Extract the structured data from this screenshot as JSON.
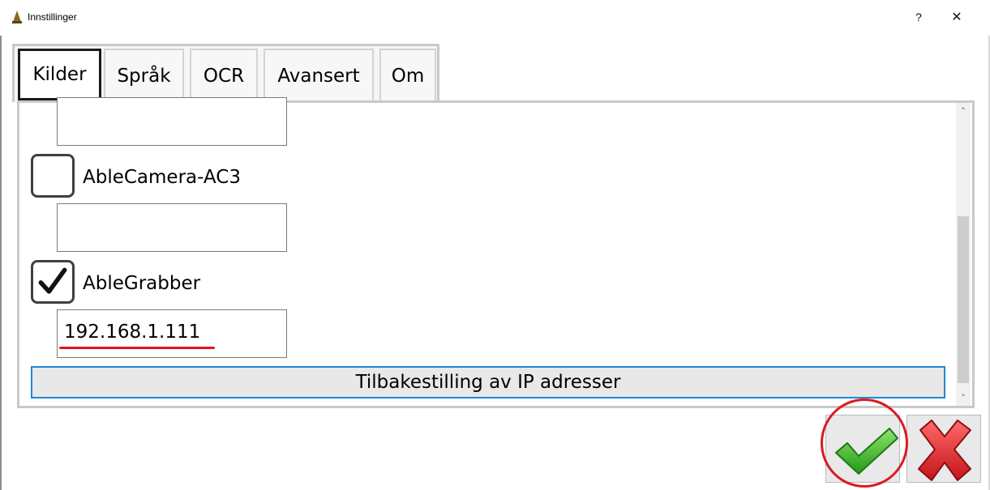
{
  "window": {
    "title": "Innstillinger",
    "help_label": "?",
    "close_label": "✕"
  },
  "tabs": [
    {
      "label": "Kilder",
      "active": true
    },
    {
      "label": "Språk",
      "active": false
    },
    {
      "label": "OCR",
      "active": false
    },
    {
      "label": "Avansert",
      "active": false
    },
    {
      "label": "Om",
      "active": false
    }
  ],
  "sources": {
    "top_field_value": "",
    "items": [
      {
        "label": "AbleCamera-AC3",
        "checked": false,
        "ip_value": ""
      },
      {
        "label": "AbleGrabber",
        "checked": true,
        "ip_value": "192.168.1.111"
      }
    ],
    "reset_button_label": "Tilbakestilling av IP adresser"
  },
  "scrollbar": {
    "up_glyph": "˄",
    "down_glyph": "˅"
  },
  "footer": {
    "ok_icon": "green-checkmark-icon",
    "cancel_icon": "red-x-icon"
  },
  "colors": {
    "active_tab_border": "#1a1a1a",
    "reset_button_border": "#1e88d9",
    "highlight_red": "#d81b21",
    "ok_green": "#3cb323"
  }
}
